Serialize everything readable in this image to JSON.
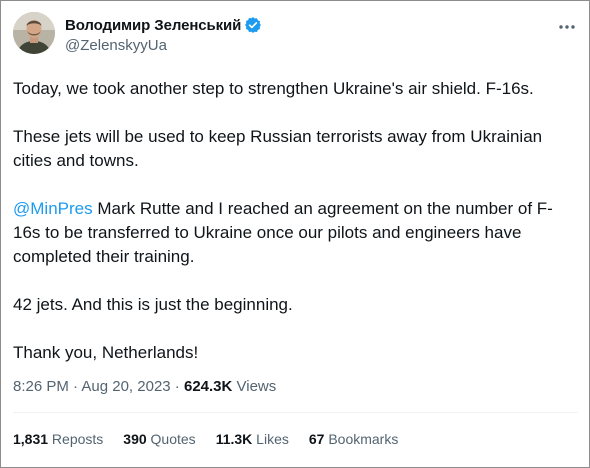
{
  "author": {
    "display_name": "Володимир Зеленський",
    "handle": "@ZelenskyyUa",
    "verified_color": "#1d9bf0",
    "avatar_icon": "profile-photo"
  },
  "tweet": {
    "paragraphs": [
      {
        "text": "Today, we took another step to strengthen Ukraine's air shield. F-16s."
      },
      {
        "text": "These jets will be used to keep Russian terrorists away from Ukrainian cities and towns."
      },
      {
        "mention": "@MinPres",
        "text": " Mark Rutte and I reached an agreement on the number of F-16s to be transferred to Ukraine once our pilots and engineers have completed their training."
      },
      {
        "text": "42 jets. And this is just the beginning."
      },
      {
        "text": "Thank you, Netherlands!"
      }
    ]
  },
  "meta": {
    "time": "8:26 PM",
    "separator": " · ",
    "date": "Aug 20, 2023",
    "views_count": "624.3K",
    "views_label": " Views"
  },
  "stats": [
    {
      "count": "1,831",
      "label": " Reposts"
    },
    {
      "count": "390",
      "label": " Quotes"
    },
    {
      "count": "11.3K",
      "label": " Likes"
    },
    {
      "count": "67",
      "label": " Bookmarks"
    }
  ],
  "colors": {
    "text": "#0f1419",
    "secondary": "#536471",
    "link": "#1d9bf0"
  }
}
